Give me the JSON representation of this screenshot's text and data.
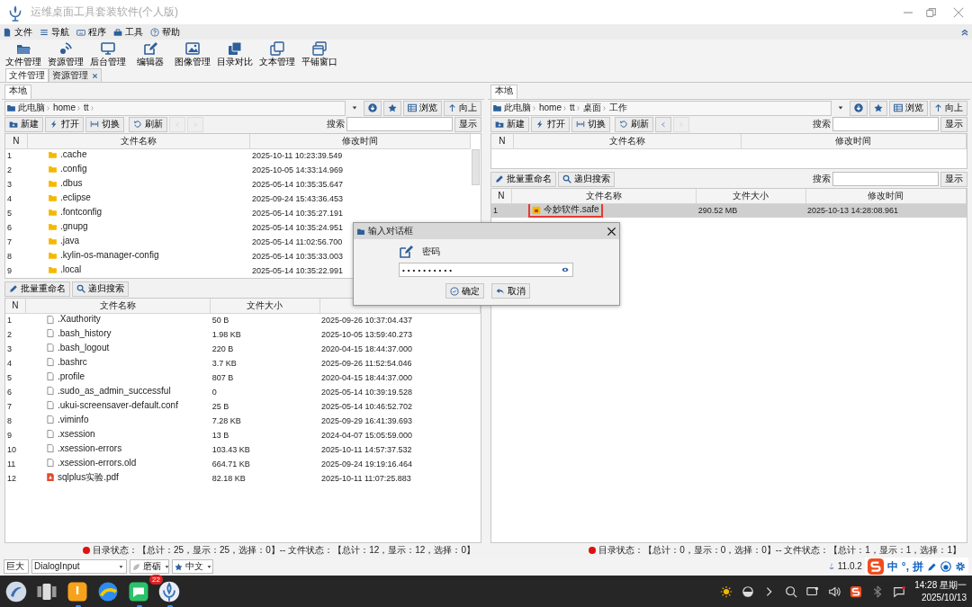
{
  "window": {
    "title": "运维桌面工具套装软件(个人版)"
  },
  "menu": [
    {
      "label": "文件"
    },
    {
      "label": "导航"
    },
    {
      "label": "程序"
    },
    {
      "label": "工具"
    },
    {
      "label": "帮助"
    }
  ],
  "toolbar": [
    {
      "label": "文件管理"
    },
    {
      "label": "资源管理"
    },
    {
      "label": "后台管理"
    },
    {
      "label": "编辑器"
    },
    {
      "label": "图像管理"
    },
    {
      "label": "目录对比"
    },
    {
      "label": "文本管理"
    },
    {
      "label": "平铺窗口"
    }
  ],
  "doc_tabs": [
    {
      "label": "文件管理",
      "selected": true,
      "closable": false
    },
    {
      "label": "资源管理",
      "selected": false,
      "closable": true
    }
  ],
  "panels": [
    {
      "tab": {
        "label": "本地",
        "selected": true
      },
      "path": [
        "此电脑",
        "home",
        "tt"
      ],
      "trailing_separator": true,
      "view_button": "浏览",
      "up_button": "向上",
      "buttons": [
        "新建",
        "打开",
        "切换",
        "刷新"
      ],
      "nav": [
        {
          "disabled": true
        },
        {
          "disabled": true
        }
      ],
      "search_label": "搜索",
      "show_button": "显示",
      "dirs": {
        "columns": [
          "N",
          "文件名称",
          "修改时间"
        ],
        "rows": [
          {
            "n": "1",
            "name": ".cache",
            "modified": "2025-10-11 10:23:39.549"
          },
          {
            "n": "2",
            "name": ".config",
            "modified": "2025-10-05 14:33:14.969"
          },
          {
            "n": "3",
            "name": ".dbus",
            "modified": "2025-05-14 10:35:35.647"
          },
          {
            "n": "4",
            "name": ".eclipse",
            "modified": "2025-09-24 15:43:36.453"
          },
          {
            "n": "5",
            "name": ".fontconfig",
            "modified": "2025-05-14 10:35:27.191"
          },
          {
            "n": "6",
            "name": ".gnupg",
            "modified": "2025-05-14 10:35:24.951"
          },
          {
            "n": "7",
            "name": ".java",
            "modified": "2025-05-14 11:02:56.700"
          },
          {
            "n": "8",
            "name": ".kylin-os-manager-config",
            "modified": "2025-05-14 10:35:33.003"
          },
          {
            "n": "9",
            "name": ".local",
            "modified": "2025-05-14 10:35:22.991"
          }
        ]
      },
      "files_toolbar": {
        "buttons": [
          "批量重命名",
          "递归搜索"
        ]
      },
      "files": {
        "columns": [
          "N",
          "文件名称",
          "文件大小"
        ],
        "rows": [
          {
            "n": "1",
            "name": ".Xauthority",
            "size": "50 B",
            "modified": "2025-09-26 10:37:04.437",
            "kind": "file",
            "selected": false,
            "highlighted": false
          },
          {
            "n": "2",
            "name": ".bash_history",
            "size": "1.98 KB",
            "modified": "2025-10-05 13:59:40.273",
            "kind": "file",
            "selected": false,
            "highlighted": false
          },
          {
            "n": "3",
            "name": ".bash_logout",
            "size": "220 B",
            "modified": "2020-04-15 18:44:37.000",
            "kind": "file",
            "selected": false,
            "highlighted": false
          },
          {
            "n": "4",
            "name": ".bashrc",
            "size": "3.7 KB",
            "modified": "2025-09-26 11:52:54.046",
            "kind": "file",
            "selected": false,
            "highlighted": false
          },
          {
            "n": "5",
            "name": ".profile",
            "size": "807 B",
            "modified": "2020-04-15 18:44:37.000",
            "kind": "file",
            "selected": false,
            "highlighted": false
          },
          {
            "n": "6",
            "name": ".sudo_as_admin_successful",
            "size": "0",
            "modified": "2025-05-14 10:39:19.528",
            "kind": "file",
            "selected": false,
            "highlighted": false
          },
          {
            "n": "7",
            "name": ".ukui-screensaver-default.conf",
            "size": "25 B",
            "modified": "2025-05-14 10:46:52.702",
            "kind": "file",
            "selected": false,
            "highlighted": false
          },
          {
            "n": "8",
            "name": ".viminfo",
            "size": "7.28 KB",
            "modified": "2025-09-29 16:41:39.693",
            "kind": "file",
            "selected": false,
            "highlighted": false
          },
          {
            "n": "9",
            "name": ".xsession",
            "size": "13 B",
            "modified": "2024-04-07 15:05:59.000",
            "kind": "file",
            "selected": false,
            "highlighted": false
          },
          {
            "n": "10",
            "name": ".xsession-errors",
            "size": "103.43 KB",
            "modified": "2025-10-11 14:57:37.532",
            "kind": "file",
            "selected": false,
            "highlighted": false
          },
          {
            "n": "11",
            "name": ".xsession-errors.old",
            "size": "664.71 KB",
            "modified": "2025-09-24 19:19:16.464",
            "kind": "file",
            "selected": false,
            "highlighted": false
          },
          {
            "n": "12",
            "name": "sqlplus实验.pdf",
            "size": "82.18 KB",
            "modified": "2025-10-11 11:07:25.883",
            "kind": "pdf",
            "selected": false,
            "highlighted": false
          }
        ]
      },
      "status": "目录状态：【总计：25，显示：25，选择：0】-- 文件状态：【总计：12，显示：12，选择：0】"
    },
    {
      "tab": {
        "label": "本地",
        "selected": true
      },
      "path": [
        "此电脑",
        "home",
        "tt",
        "桌面",
        "工作"
      ],
      "trailing_separator": false,
      "view_button": "浏览",
      "up_button": "向上",
      "buttons": [
        "新建",
        "打开",
        "切换",
        "刷新"
      ],
      "nav": [
        {
          "disabled": false
        },
        {
          "disabled": true
        }
      ],
      "search_label": "搜索",
      "show_button": "显示",
      "dirs": {
        "columns": [
          "N",
          "文件名称",
          "修改时间"
        ]
      },
      "files_toolbar": {
        "buttons": [
          "批量重命名",
          "递归搜索"
        ],
        "search_label": "搜索",
        "show_button": "显示"
      },
      "files": {
        "columns": [
          "N",
          "文件名称",
          "文件大小",
          "修改时间"
        ],
        "rows": [
          {
            "n": "1",
            "name": "今妙软件.safe",
            "size": "290.52 MB",
            "modified": "2025-10-13 14:28:08.961",
            "kind": "safe",
            "selected": true,
            "highlighted": true
          }
        ]
      },
      "status": "目录状态：【总计：0，显示：0，选择：0】-- 文件状态：【总计：1，显示：1，选择：1】"
    }
  ],
  "dialog": {
    "title": "输入对话框",
    "label": "密码",
    "value": "••••••••••",
    "ok": "确定",
    "cancel": "取消"
  },
  "bottom_bar": {
    "selects": [
      {
        "value": "巨大"
      },
      {
        "value": "DialogInput"
      },
      {
        "value": "磨砺"
      },
      {
        "value": "中文"
      }
    ],
    "version": "11.0.2",
    "ime": [
      "中",
      "°,",
      "拼"
    ]
  },
  "taskbar": {
    "apps": [
      {
        "running": false
      },
      {
        "running": false
      },
      {
        "running": true
      },
      {
        "running": false
      },
      {
        "running": true,
        "badge": "22"
      },
      {
        "running": true
      }
    ],
    "time": "14:28 星期一",
    "date": "2025/10/13"
  }
}
